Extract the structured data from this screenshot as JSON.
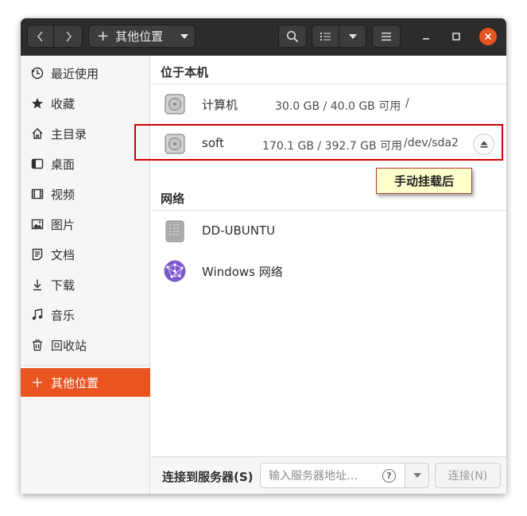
{
  "header": {
    "back_icon": "chevron-left-icon",
    "forward_icon": "chevron-right-icon",
    "path_label": "其他位置",
    "search_icon": "search-icon",
    "view_icon": "list-view-icon",
    "menu_icon": "hamburger-icon"
  },
  "sidebar": {
    "items": [
      {
        "label": "最近使用",
        "icon": "clock-icon"
      },
      {
        "label": "收藏",
        "icon": "star-icon"
      },
      {
        "label": "主目录",
        "icon": "home-icon"
      },
      {
        "label": "桌面",
        "icon": "desktop-icon"
      },
      {
        "label": "视频",
        "icon": "film-icon"
      },
      {
        "label": "图片",
        "icon": "image-icon"
      },
      {
        "label": "文档",
        "icon": "document-icon"
      },
      {
        "label": "下载",
        "icon": "download-icon"
      },
      {
        "label": "音乐",
        "icon": "music-icon"
      },
      {
        "label": "回收站",
        "icon": "trash-icon"
      }
    ],
    "other": {
      "label": "其他位置",
      "icon": "plus-icon"
    }
  },
  "main": {
    "local_title": "位于本机",
    "locations": [
      {
        "name": "计算机",
        "size": "30.0 GB / 40.0 GB 可用",
        "path": "/"
      },
      {
        "name": "soft",
        "size": "170.1 GB / 392.7 GB 可用",
        "path": "/dev/sda2"
      }
    ],
    "network_title": "网络",
    "network": [
      {
        "name": "DD-UBUNTU"
      },
      {
        "name": "Windows 网络"
      }
    ]
  },
  "annotation": {
    "text": "手动挂载后",
    "highlight_color": "#d40000",
    "note_bg": "#ffffcc"
  },
  "bottom": {
    "label": "连接到服务器(S)",
    "placeholder": "输入服务器地址…",
    "connect_label": "连接(N)"
  },
  "colors": {
    "accent": "#e95420",
    "header_bg": "#2c2c2c"
  }
}
